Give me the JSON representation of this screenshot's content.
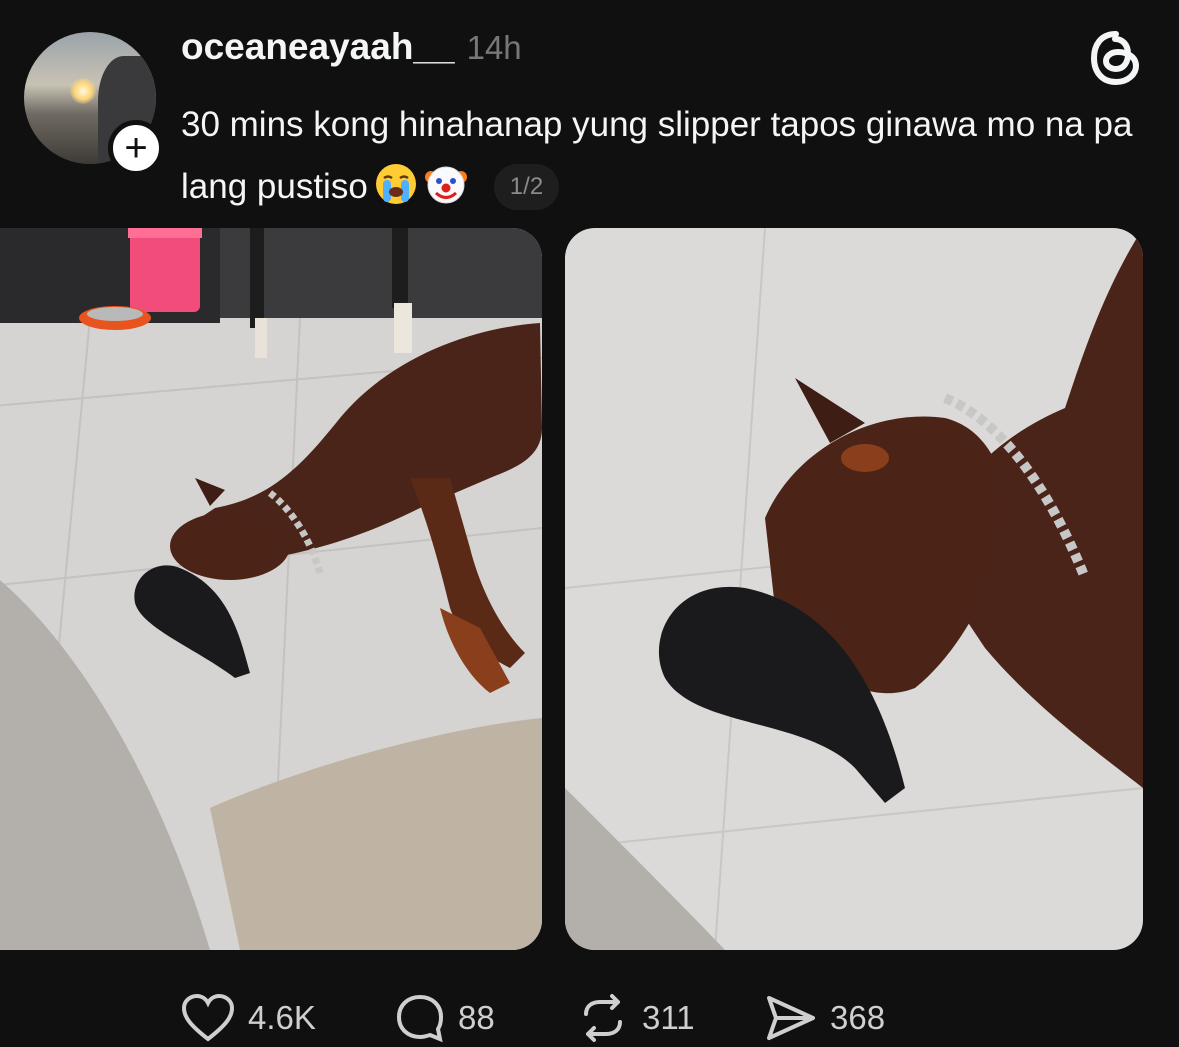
{
  "post": {
    "username": "oceaneayaah__",
    "timestamp": "14h",
    "text": "30 mins kong hinahanap yung slipper tapos ginawa mo na pa lang pustiso",
    "emojis": [
      "loudly-crying-face",
      "clown-face"
    ],
    "page_indicator": "1/2",
    "follow_symbol": "+"
  },
  "media": [
    {
      "label": "dog-photo-1"
    },
    {
      "label": "dog-photo-2"
    }
  ],
  "actions": {
    "likes": "4.6K",
    "replies": "88",
    "reposts": "311",
    "shares": "368"
  },
  "colors": {
    "background": "#101010",
    "text": "#f3f5f7",
    "muted": "#777777"
  }
}
